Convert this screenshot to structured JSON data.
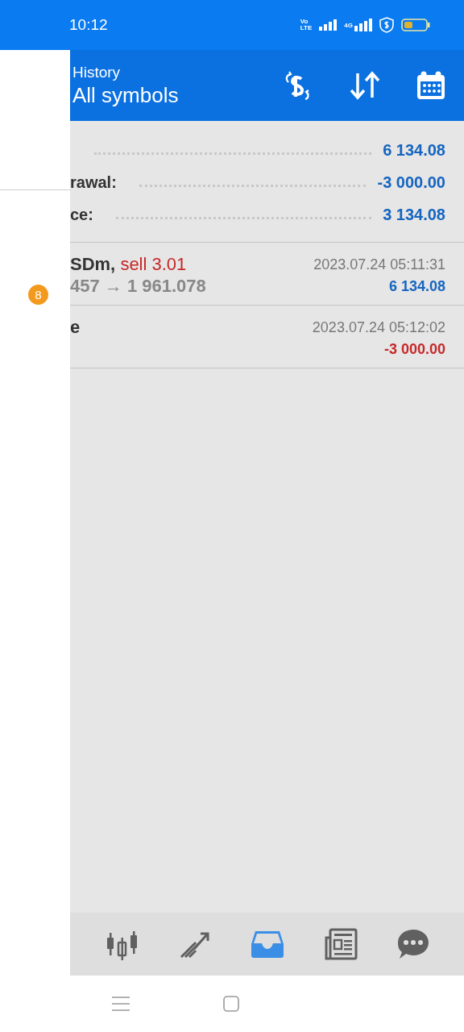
{
  "status_bar": {
    "time": "10:12",
    "volte": [
      "Vo",
      "LTE"
    ],
    "network": "4G"
  },
  "drawer": {
    "badge": "8"
  },
  "header": {
    "title": "History",
    "subtitle": "All symbols"
  },
  "summary": [
    {
      "value": "6 134.08"
    },
    {
      "label": "rawal:",
      "value": "-3 000.00"
    },
    {
      "label": "ce:",
      "value": "3 134.08"
    }
  ],
  "deals": [
    {
      "symbol": "SDm,",
      "action": "sell 3.01",
      "prices": "457 → 1 961.078",
      "time": "2023.07.24 05:11:31",
      "amount": "6 134.08",
      "color": "#1565c0"
    },
    {
      "symbol": "e",
      "time": "2023.07.24 05:12:02",
      "amount": "-3 000.00",
      "color": "#c62828"
    }
  ],
  "nav": {
    "items": [
      {
        "kind": "quotes",
        "selected": false
      },
      {
        "kind": "chart",
        "selected": false
      },
      {
        "kind": "history",
        "selected": true
      },
      {
        "kind": "news",
        "selected": false
      },
      {
        "kind": "chat",
        "selected": false
      }
    ]
  }
}
